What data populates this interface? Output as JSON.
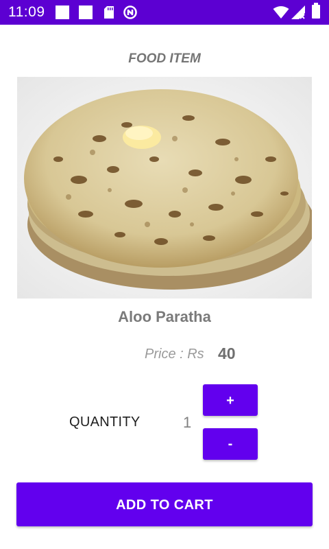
{
  "status_bar": {
    "time": "11:09",
    "icons": [
      "notification-square-icon",
      "notification-square-icon",
      "sd-card-icon",
      "nfc-icon",
      "wifi-icon",
      "cell-signal-icon",
      "battery-icon"
    ],
    "color": "#5c00d2"
  },
  "page": {
    "title": "FOOD ITEM",
    "item_name": "Aloo Paratha",
    "price_label": "Price  : Rs",
    "price_value": "40",
    "quantity_label": "QUANTITY",
    "quantity_value": "1",
    "increment_label": "+",
    "decrement_label": "-",
    "add_to_cart_label": "ADD TO CART"
  },
  "colors": {
    "accent": "#6200ee",
    "title_text": "#757575"
  }
}
